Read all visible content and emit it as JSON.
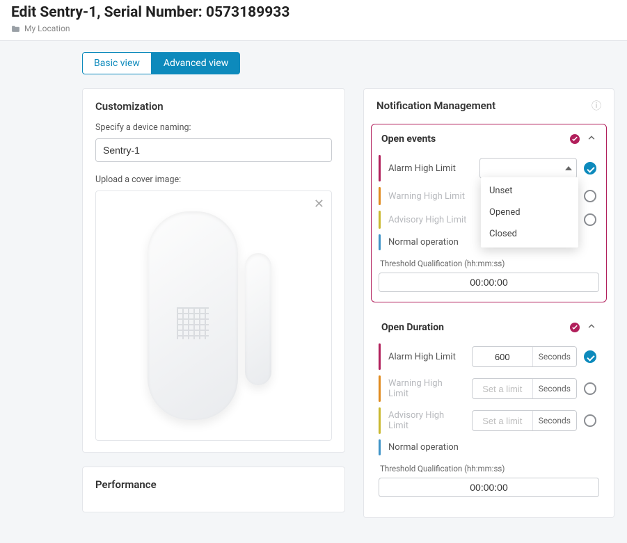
{
  "header": {
    "title": "Edit Sentry-1, Serial Number: 0573189933",
    "breadcrumb": "My Location"
  },
  "tabs": {
    "basic": "Basic view",
    "advanced": "Advanced view"
  },
  "customization": {
    "title": "Customization",
    "naming_label": "Specify a device naming:",
    "naming_value": "Sentry-1",
    "cover_label": "Upload a cover image:"
  },
  "performance": {
    "title": "Performance"
  },
  "notification": {
    "title": "Notification Management",
    "sections": {
      "open_events": {
        "name": "Open events",
        "limits": {
          "alarm": {
            "label": "Alarm High Limit",
            "value": "",
            "enabled": true
          },
          "warning": {
            "label": "Warning High Limit",
            "value": "",
            "enabled": false
          },
          "advisory": {
            "label": "Advisory High Limit",
            "value": "",
            "enabled": false
          },
          "normal": {
            "label": "Normal operation"
          }
        },
        "dropdown_options": [
          "Unset",
          "Opened",
          "Closed"
        ],
        "tq_label": "Threshold Qualification (hh:mm:ss)",
        "tq_value": "00:00:00"
      },
      "open_duration": {
        "name": "Open Duration",
        "unit": "Seconds",
        "placeholder": "Set a limit",
        "limits": {
          "alarm": {
            "label": "Alarm High Limit",
            "value": "600",
            "enabled": true
          },
          "warning": {
            "label": "Warning High Limit",
            "value": "",
            "enabled": false
          },
          "advisory": {
            "label": "Advisory High Limit",
            "value": "",
            "enabled": false
          },
          "normal": {
            "label": "Normal operation"
          }
        },
        "tq_label": "Threshold Qualification (hh:mm:ss)",
        "tq_value": "00:00:00"
      }
    }
  }
}
